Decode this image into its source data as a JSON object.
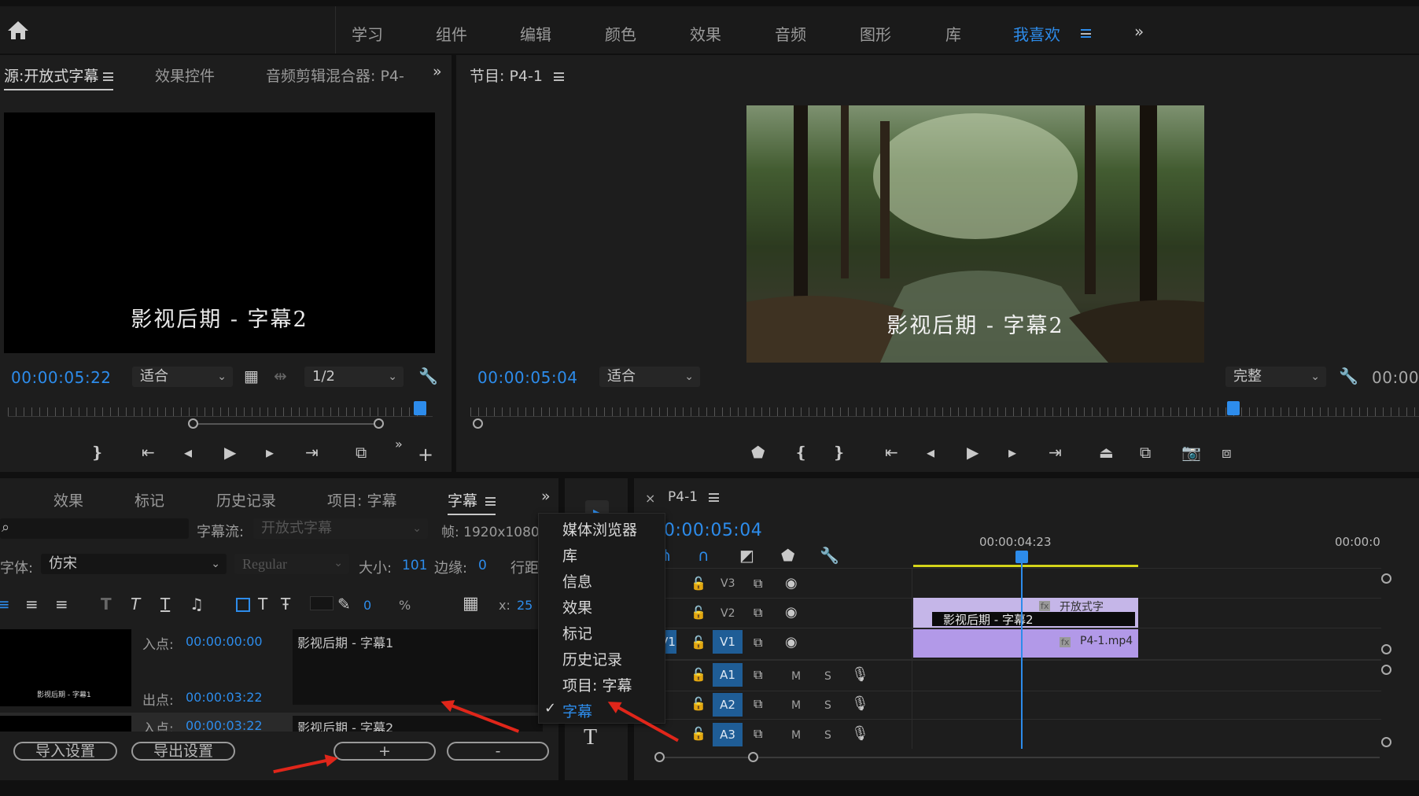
{
  "topbar": {
    "home_icon": "home-icon",
    "workspaces": [
      "学习",
      "组件",
      "编辑",
      "颜色",
      "效果",
      "音频",
      "图形",
      "库"
    ],
    "active_workspace": "我喜欢",
    "more": "»"
  },
  "source_panel": {
    "tabs": {
      "source": "源:开放式字幕",
      "effect_controls": "效果控件",
      "audio_mixer": "音频剪辑混合器: P4-"
    },
    "more": "»",
    "caption_text": "影视后期 - 字幕2",
    "timecode": "00:00:05:22",
    "zoom": "适合",
    "resolution": "1/2"
  },
  "program_panel": {
    "title": "节目: P4-1",
    "caption_text": "影视后期 - 字幕2",
    "timecode": "00:00:05:04",
    "zoom": "适合",
    "quality": "完整",
    "timecode_right": "00:00:"
  },
  "captions_panel": {
    "tabs": {
      "effects": "效果",
      "markers": "标记",
      "history": "历史记录",
      "project": "项目: 字幕",
      "captions": "字幕"
    },
    "more": "»",
    "stream_label": "字幕流:",
    "stream_value": "开放式字幕",
    "frame_label": "帧:",
    "frame_value": "1920x1080",
    "font_label": "字体:",
    "font_value": "仿宋",
    "style_value": "Regular",
    "size_label": "大小:",
    "size_value": "101",
    "edge_label": "边缘:",
    "edge_value": "0",
    "line_label": "行距",
    "opacity_value": "0",
    "opacity_unit": "%",
    "x_label": "x:",
    "x_value": "25",
    "entries": [
      {
        "in_label": "入点:",
        "in": "00:00:00:00",
        "out_label": "出点:",
        "out": "00:00:03:22",
        "text": "影视后期 - 字幕1",
        "thumb_text": "影视后期 - 字幕1"
      },
      {
        "in_label": "入点:",
        "in": "00:00:03:22",
        "text": "影视后期 - 字幕2"
      }
    ],
    "import_btn": "导入设置",
    "export_btn": "导出设置",
    "add_btn": "+",
    "remove_btn": "-"
  },
  "window_menu": {
    "items": [
      "媒体浏览器",
      "库",
      "信息",
      "效果",
      "标记",
      "历史记录",
      "项目: 字幕",
      "字幕"
    ],
    "checked_index": 7
  },
  "timeline": {
    "title": "P4-1",
    "timecode": "0:00:05:04",
    "ruler_label_1": "00:00:04:23",
    "ruler_label_2": "00:00:0",
    "tracks": {
      "v3": "V3",
      "v2": "V2",
      "v1": "V1",
      "v1_src": "V1",
      "a1": "A1",
      "a2": "A2",
      "a3": "A3",
      "mute": "M",
      "solo": "S"
    },
    "clip_caption_label": "开放式字",
    "clip_caption_text": "影视后期 - 字幕2",
    "clip_fx": "fx",
    "clip_video": "P4-1.mp4"
  },
  "colors": {
    "accent": "#2d8ceb",
    "clip_purple": "#b299e8",
    "track_blue": "#1f5d96",
    "arrow_red": "#e0261a",
    "caption_yellow": "#d4d41a"
  }
}
